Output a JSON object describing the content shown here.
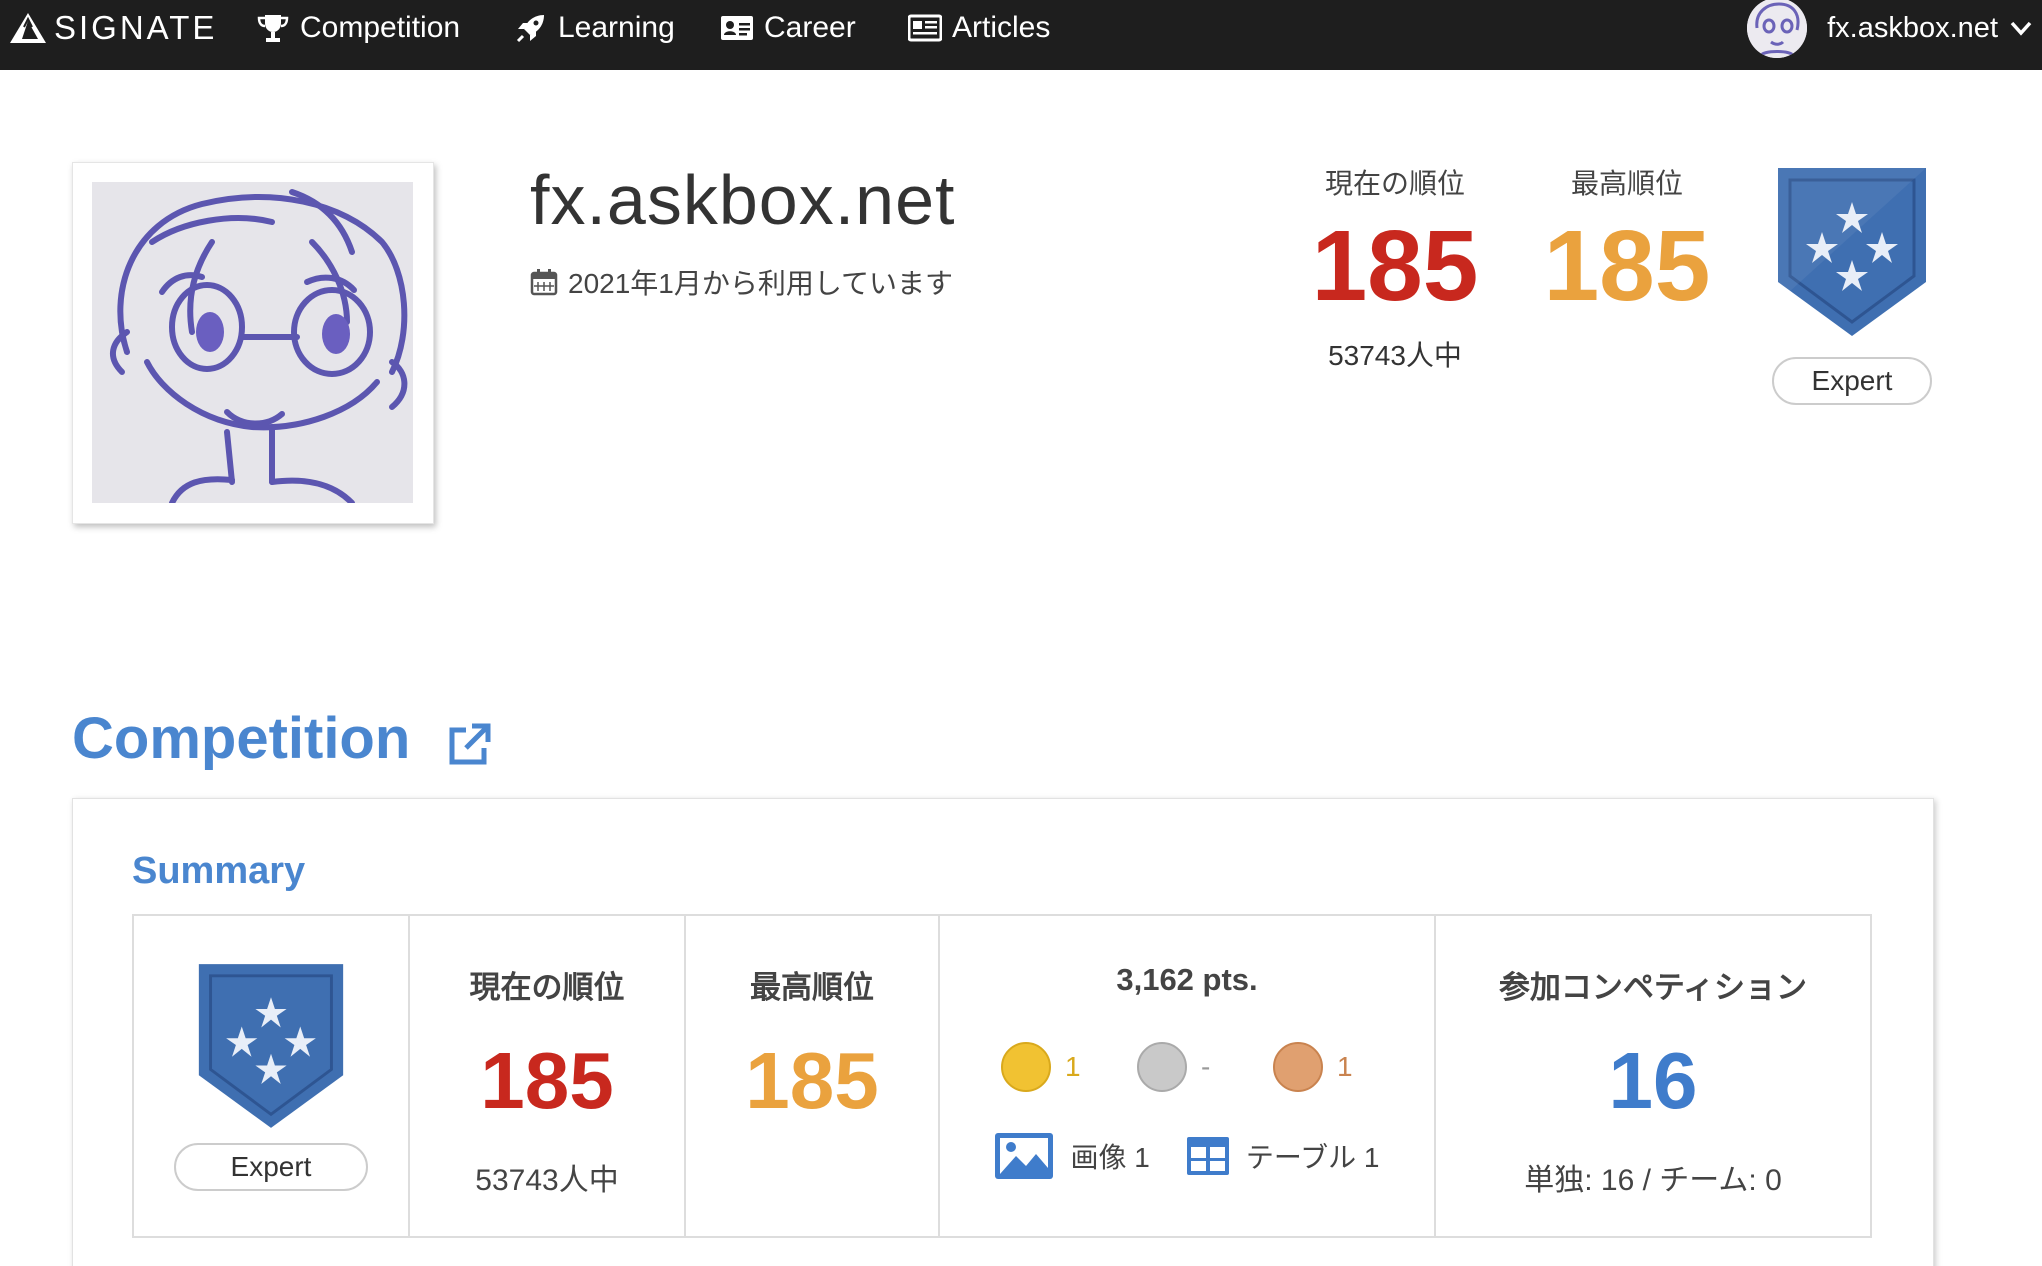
{
  "nav": {
    "brand": "SIGNATE",
    "items": [
      {
        "label": "Competition",
        "icon": "trophy-icon"
      },
      {
        "label": "Learning",
        "icon": "rocket-icon"
      },
      {
        "label": "Career",
        "icon": "id-card-icon"
      },
      {
        "label": "Articles",
        "icon": "newspaper-icon"
      }
    ],
    "user": "fx.askbox.net"
  },
  "profile": {
    "name": "fx.askbox.net",
    "since": "2021年1月から利用しています",
    "current_rank_label": "現在の順位",
    "current_rank": "185",
    "total_users": "53743人中",
    "best_rank_label": "最高順位",
    "best_rank": "185",
    "tier": "Expert"
  },
  "competition": {
    "title": "Competition",
    "summary_title": "Summary",
    "tier": "Expert",
    "current_rank_label": "現在の順位",
    "current_rank": "185",
    "total_users": "53743人中",
    "best_rank_label": "最高順位",
    "best_rank": "185",
    "points": "3,162 pts.",
    "medals": {
      "gold": "1",
      "silver": "-",
      "bronze": "1"
    },
    "categories": {
      "image_label": "画像 1",
      "table_label": "テーブル 1"
    },
    "participation_label": "参加コンペティション",
    "participation_count": "16",
    "participation_breakdown": "単独: 16 / チーム: 0"
  },
  "colors": {
    "nav_bg": "#1e1e1e",
    "rank_red": "#c8281e",
    "rank_orange": "#eaa23e",
    "accent_blue": "#4a86cf",
    "badge_blue": "#3f6fb1",
    "gold": "#f1c232",
    "silver": "#c9c9c9",
    "bronze": "#e0a070"
  }
}
